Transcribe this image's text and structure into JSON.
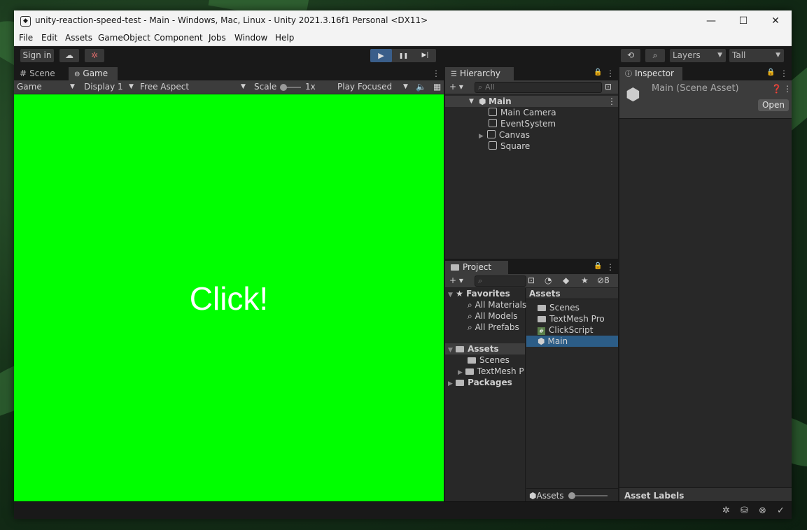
{
  "window": {
    "title": "unity-reaction-speed-test - Main - Windows, Mac, Linux - Unity 2021.3.16f1 Personal <DX11>",
    "minimize": "—",
    "maximize": "☐",
    "close": "✕"
  },
  "menu": [
    "File",
    "Edit",
    "Assets",
    "GameObject",
    "Component",
    "Jobs",
    "Window",
    "Help"
  ],
  "toolbar": {
    "sign_in": "Sign in",
    "cloud_icon": "☁",
    "collab_icon": "✲",
    "play": "▶",
    "pause": "❚❚",
    "step": "▶|",
    "history_icon": "⟲",
    "search_icon": "⌕",
    "layers": "Layers",
    "layout": "Tall"
  },
  "scene_game": {
    "tab_scene": "Scene",
    "tab_game": "Game",
    "game_dropdown": "Game",
    "display": "Display 1",
    "aspect": "Free Aspect",
    "scale_label": "Scale",
    "scale_value": "1x",
    "play_mode": "Play Focused",
    "game_text": "Click!",
    "game_background": "#00ff00"
  },
  "hierarchy": {
    "tab": "Hierarchy",
    "search_placeholder": "All",
    "scene": "Main",
    "items": [
      "Main Camera",
      "EventSystem",
      "Canvas",
      "Square"
    ]
  },
  "inspector": {
    "tab": "Inspector",
    "asset_title": "Main (Scene Asset)",
    "open_button": "Open",
    "asset_labels": "Asset Labels"
  },
  "project": {
    "tab": "Project",
    "hidden_count": "8",
    "favorites": "Favorites",
    "favorite_items": [
      "All Materials",
      "All Models",
      "All Prefabs"
    ],
    "assets_root": "Assets",
    "asset_folders": [
      "Scenes",
      "TextMesh P"
    ],
    "packages": "Packages",
    "content_header": "Assets",
    "content_items": [
      "Scenes",
      "TextMesh Pro",
      "ClickScript",
      "Main"
    ],
    "footer_path": "Assets"
  }
}
